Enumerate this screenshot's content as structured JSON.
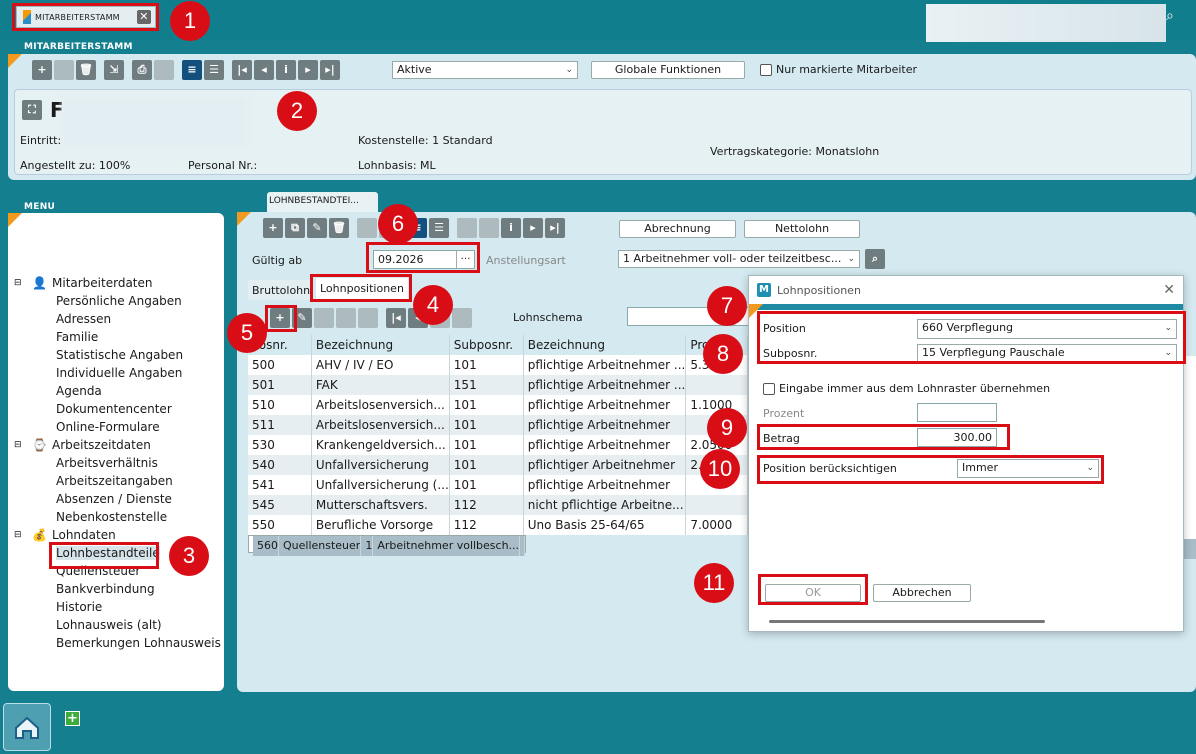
{
  "window_tab": {
    "label": "MITARBEITERSTAMM"
  },
  "employee_panel": {
    "header": "MITARBEITERSTAMM",
    "filter": "Aktive",
    "global_btn": "Globale Funktionen",
    "only_marked": "Nur markierte Mitarbeiter",
    "name_initial": "F",
    "eintritt": "Eintritt:",
    "kostenstelle": "Kostenstelle: 1 Standard",
    "angestellt": "Angestellt zu: 100%",
    "personal_nr": "Personal Nr.:",
    "lohnbasis": "Lohnbasis: ML",
    "vertragskategorie": "Vertragskategorie: Monatslohn"
  },
  "menu": {
    "header": "MENU",
    "groups": [
      {
        "label": "Mitarbeiterdaten",
        "items": [
          "Persönliche Angaben",
          "Adressen",
          "Familie",
          "Statistische Angaben",
          "Individuelle Angaben",
          "Agenda",
          "Dokumentencenter",
          "Online-Formulare"
        ]
      },
      {
        "label": "Arbeitszeitdaten",
        "items": [
          "Arbeitsverhältnis",
          "Arbeitszeitangaben",
          "Absenzen / Dienste",
          "Nebenkostenstelle"
        ]
      },
      {
        "label": "Lohndaten",
        "items": [
          "Lohnbestandteile",
          "Quellensteuer",
          "Bankverbindung",
          "Historie",
          "Lohnausweis (alt)",
          "Bemerkungen Lohnausweis"
        ]
      }
    ]
  },
  "content": {
    "tab_label": "LOHNBESTANDTEI...",
    "abrechnung_btn": "Abrechnung",
    "nettolohn_btn": "Nettolohn",
    "gueltig_label": "Gültig ab",
    "gueltig_value": "09.2026",
    "anstellungsart_label": "Anstellungsart",
    "anstellungsart_value": "1 Arbeitnehmer voll- oder teilzeitbesc...",
    "subtabs": [
      "Bruttolohn",
      "Lohnpositionen"
    ],
    "lohnschema_label": "Lohnschema",
    "columns": [
      "Posnr.",
      "Bezeichnung",
      "Subposnr.",
      "Bezeichnung",
      "Prozent"
    ],
    "rows": [
      [
        "500",
        "AHV / IV / EO",
        "101",
        "pflichtige Arbeitnehmer ...",
        "5.300"
      ],
      [
        "501",
        "FAK",
        "151",
        "pflichtige Arbeitnehmer ...",
        ""
      ],
      [
        "510",
        "Arbeitslosenversich...",
        "101",
        "pflichtige Arbeitnehmer",
        "1.1000"
      ],
      [
        "511",
        "Arbeitslosenversich...",
        "101",
        "pflichtige Arbeitnehmer",
        ""
      ],
      [
        "530",
        "Krankengeldversich...",
        "101",
        "pflichtige Arbeitnehmer",
        "2.0500"
      ],
      [
        "540",
        "Unfallversicherung",
        "101",
        "pflichtiger Arbeitnehmer",
        "2.0"
      ],
      [
        "541",
        "Unfallversicherung (...",
        "101",
        "pflichtige Arbeitnehmer",
        ""
      ],
      [
        "545",
        "Mutterschaftsvers.",
        "112",
        "nicht pflichtige Arbeitne...",
        ""
      ],
      [
        "550",
        "Berufliche Vorsorge",
        "112",
        "Uno Basis 25-64/65",
        "7.0000"
      ],
      [
        "560",
        "Quellensteuer",
        "1",
        "Arbeitnehmer vollbesch...",
        ""
      ]
    ]
  },
  "dialog": {
    "title": "Lohnpositionen",
    "position_label": "Position",
    "position_value": "660 Verpflegung",
    "subposnr_label": "Subposnr.",
    "subposnr_value": "15 Verpflegung Pauschale",
    "raster_label": "Eingabe immer aus dem Lohnraster übernehmen",
    "prozent_label": "Prozent",
    "betrag_label": "Betrag",
    "betrag_value": "300.00",
    "beruecksichtigen_label": "Position berücksichtigen",
    "beruecksichtigen_value": "Immer",
    "ok": "OK",
    "cancel": "Abbrechen"
  },
  "annotations": [
    "1",
    "2",
    "3",
    "4",
    "5",
    "6",
    "7",
    "8",
    "9",
    "10",
    "11"
  ]
}
